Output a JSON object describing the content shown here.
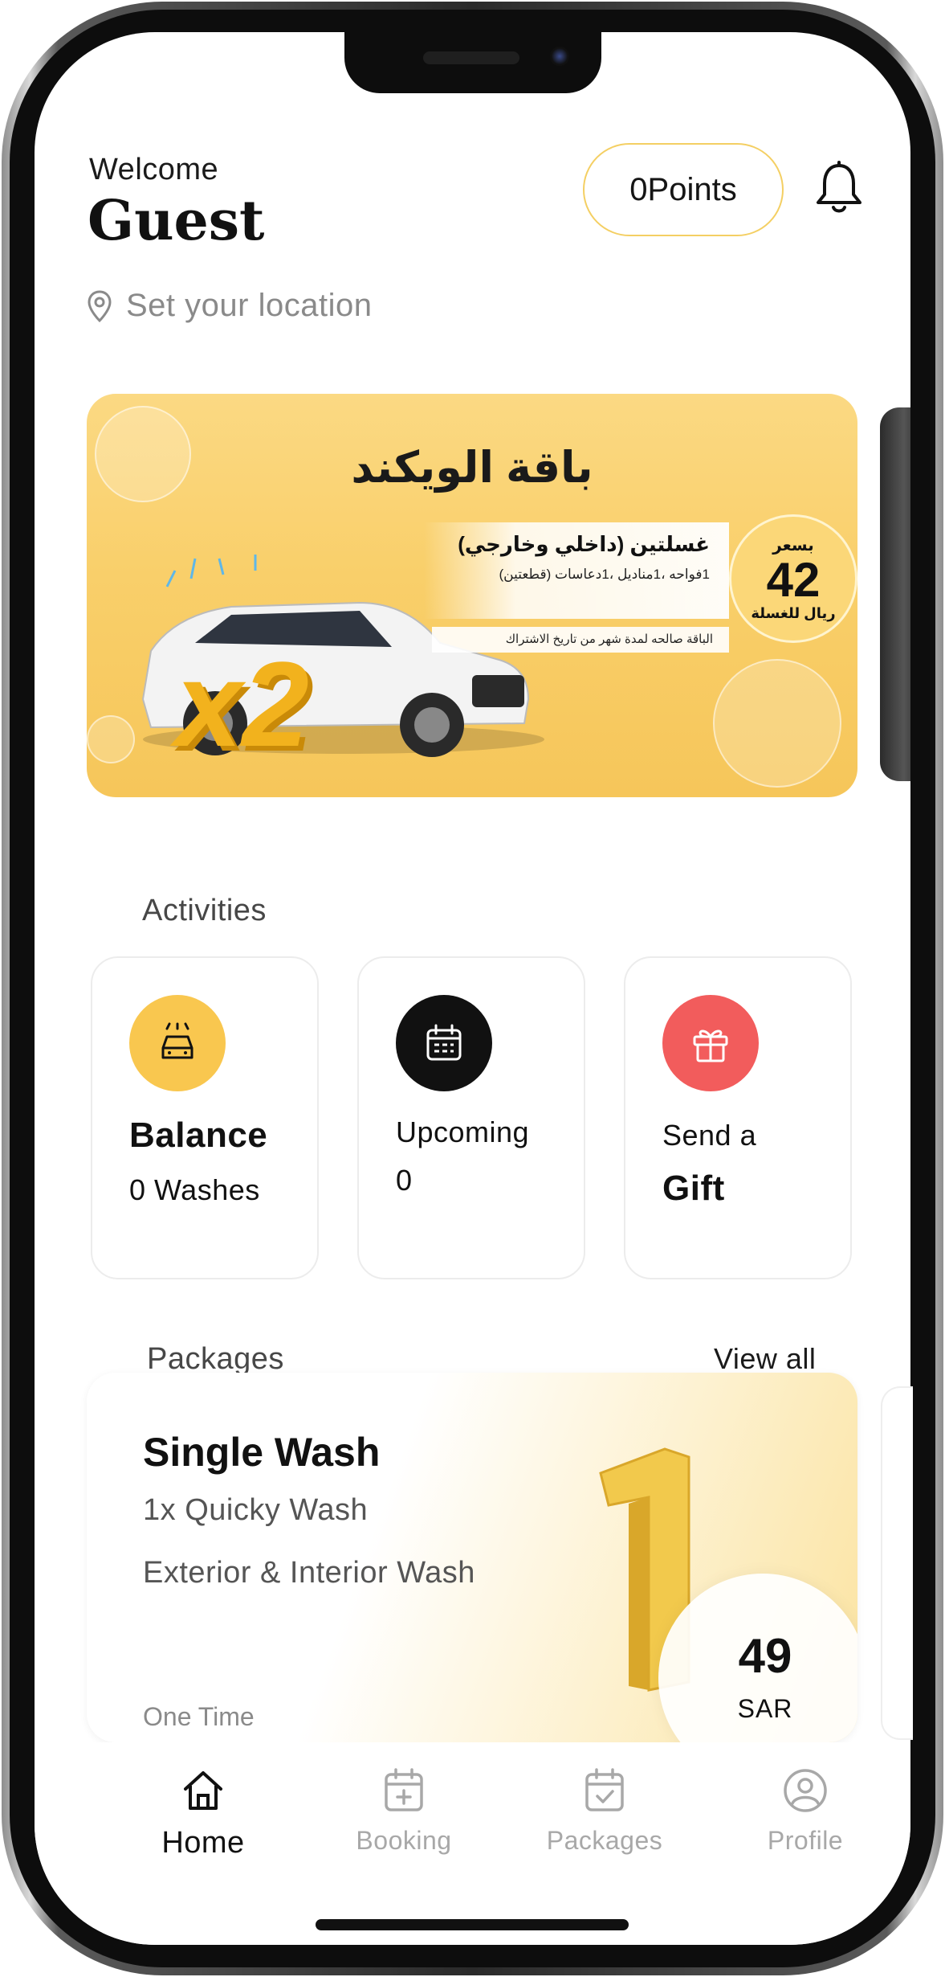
{
  "header": {
    "welcome": "Welcome",
    "name": "Guest",
    "location_placeholder": "Set your location",
    "points": "0Points"
  },
  "banner": {
    "title": "باقة الويكند",
    "offer_line1": "غسلتين (داخلي وخارجي)",
    "offer_line2": "1فواحه ،1مناديل ،1دعاسات (قطعتين)",
    "offer_footer": "الباقة صالحه لمدة شهر من تاريخ الاشتراك",
    "price_prefix": "بسعر",
    "price": "42",
    "price_suffix": "ريال للغسلة",
    "multiplier": "x2"
  },
  "activities": {
    "title": "Activities",
    "balance": {
      "title": "Balance",
      "value": "0 Washes",
      "icon": "car-wash-icon",
      "color": "#F9C74F"
    },
    "upcoming": {
      "title": "Upcoming",
      "value": "0",
      "icon": "calendar-icon",
      "color": "#111111"
    },
    "gift": {
      "line1": "Send a",
      "line2": "Gift",
      "icon": "gift-icon",
      "color": "#F25C5C"
    }
  },
  "packages": {
    "title": "Packages",
    "view_all": "View all",
    "items": [
      {
        "name": "Single Wash",
        "subtitle": "1x Quicky Wash",
        "description": "Exterior & Interior Wash",
        "frequency": "One Time",
        "price": "49",
        "currency": "SAR"
      }
    ]
  },
  "nav": {
    "items": [
      {
        "label": "Home",
        "icon": "home-icon",
        "active": true
      },
      {
        "label": "Booking",
        "icon": "calendar-plus-icon",
        "active": false
      },
      {
        "label": "Packages",
        "icon": "calendar-check-icon",
        "active": false
      },
      {
        "label": "Profile",
        "icon": "user-circle-icon",
        "active": false
      }
    ]
  },
  "colors": {
    "accent": "#F9C74F",
    "gift": "#F25C5C",
    "dark": "#111111"
  }
}
